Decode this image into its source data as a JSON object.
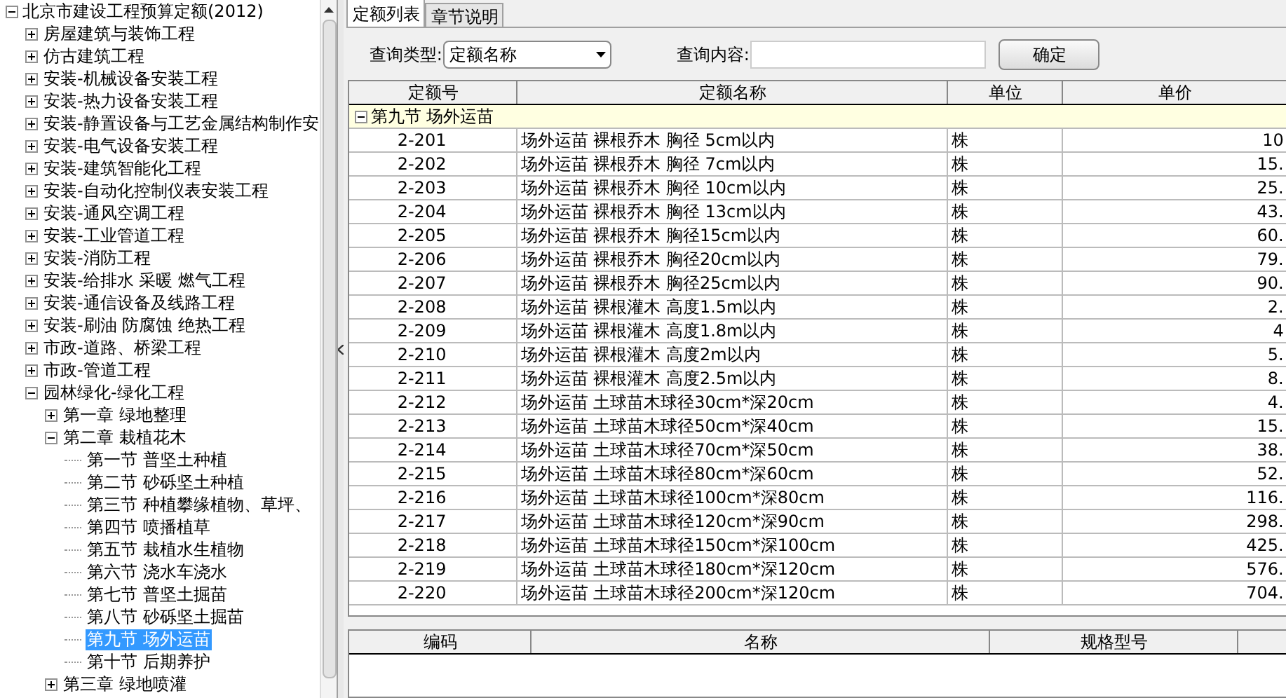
{
  "tree": {
    "label": "北京市建设工程预算定额(2012)",
    "expanded": true,
    "children": [
      {
        "label": "房屋建筑与装饰工程",
        "expanded": false,
        "selected": false
      },
      {
        "label": "仿古建筑工程",
        "expanded": false,
        "selected": false
      },
      {
        "label": "安装-机械设备安装工程",
        "expanded": false,
        "selected": false
      },
      {
        "label": "安装-热力设备安装工程",
        "expanded": false,
        "selected": false
      },
      {
        "label": "安装-静置设备与工艺金属结构制作安",
        "expanded": false,
        "selected": false
      },
      {
        "label": "安装-电气设备安装工程",
        "expanded": false,
        "selected": false
      },
      {
        "label": "安装-建筑智能化工程",
        "expanded": false,
        "selected": false
      },
      {
        "label": "安装-自动化控制仪表安装工程",
        "expanded": false,
        "selected": false
      },
      {
        "label": "安装-通风空调工程",
        "expanded": false,
        "selected": false
      },
      {
        "label": "安装-工业管道工程",
        "expanded": false,
        "selected": false
      },
      {
        "label": "安装-消防工程",
        "expanded": false,
        "selected": false
      },
      {
        "label": "安装-给排水 采暖 燃气工程",
        "expanded": false,
        "selected": false
      },
      {
        "label": "安装-通信设备及线路工程",
        "expanded": false,
        "selected": false
      },
      {
        "label": "安装-刷油 防腐蚀 绝热工程",
        "expanded": false,
        "selected": false
      },
      {
        "label": "市政-道路、桥梁工程",
        "expanded": false,
        "selected": false
      },
      {
        "label": "市政-管道工程",
        "expanded": false,
        "selected": false
      },
      {
        "label": "园林绿化-绿化工程",
        "expanded": true,
        "selected": false,
        "children": [
          {
            "label": "第一章 绿地整理",
            "expanded": false,
            "selected": false
          },
          {
            "label": "第二章 栽植花木",
            "expanded": true,
            "selected": false,
            "children": [
              {
                "label": "第一节 普坚土种植",
                "selected": false
              },
              {
                "label": "第二节 砂砾坚土种植",
                "selected": false
              },
              {
                "label": "第三节 种植攀缘植物、草坪、",
                "selected": false
              },
              {
                "label": "第四节 喷播植草",
                "selected": false
              },
              {
                "label": "第五节 栽植水生植物",
                "selected": false
              },
              {
                "label": "第六节 浇水车浇水",
                "selected": false
              },
              {
                "label": "第七节 普坚土掘苗",
                "selected": false
              },
              {
                "label": "第八节 砂砾坚土掘苗",
                "selected": false
              },
              {
                "label": "第九节 场外运苗",
                "selected": true
              },
              {
                "label": "第十节 后期养护",
                "selected": false
              }
            ]
          },
          {
            "label": "第三章 绿地喷灌",
            "expanded": false,
            "selected": false
          }
        ]
      }
    ]
  },
  "tabs": [
    {
      "label": "定额列表",
      "selected": true
    },
    {
      "label": "章节说明",
      "selected": false
    }
  ],
  "query": {
    "type_label": "查询类型:",
    "type_value": "定额名称",
    "content_label": "查询内容:",
    "confirm": "确定"
  },
  "table": {
    "columns": [
      "定额号",
      "定额名称",
      "单位",
      "单价"
    ],
    "group": {
      "label": "第九节 场外运苗",
      "expanded": true
    },
    "rows": [
      [
        "2-201",
        "场外运苗 裸根乔木 胸径 5cm以内",
        "株",
        "10"
      ],
      [
        "2-202",
        "场外运苗 裸根乔木 胸径 7cm以内",
        "株",
        "15."
      ],
      [
        "2-203",
        "场外运苗 裸根乔木 胸径 10cm以内",
        "株",
        "25."
      ],
      [
        "2-204",
        "场外运苗 裸根乔木 胸径 13cm以内",
        "株",
        "43."
      ],
      [
        "2-205",
        "场外运苗 裸根乔木 胸径15cm以内",
        "株",
        "60."
      ],
      [
        "2-206",
        "场外运苗 裸根乔木 胸径20cm以内",
        "株",
        "79."
      ],
      [
        "2-207",
        "场外运苗 裸根乔木 胸径25cm以内",
        "株",
        "90."
      ],
      [
        "2-208",
        "场外运苗 裸根灌木 高度1.5m以内",
        "株",
        "2."
      ],
      [
        "2-209",
        "场外运苗 裸根灌木 高度1.8m以内",
        "株",
        "4"
      ],
      [
        "2-210",
        "场外运苗 裸根灌木 高度2m以内",
        "株",
        "5."
      ],
      [
        "2-211",
        "场外运苗 裸根灌木 高度2.5m以内",
        "株",
        "8."
      ],
      [
        "2-212",
        "场外运苗 土球苗木球径30cm*深20cm",
        "株",
        "4."
      ],
      [
        "2-213",
        "场外运苗 土球苗木球径50cm*深40cm",
        "株",
        "15."
      ],
      [
        "2-214",
        "场外运苗 土球苗木球径70cm*深50cm",
        "株",
        "38."
      ],
      [
        "2-215",
        "场外运苗 土球苗木球径80cm*深60cm",
        "株",
        "52."
      ],
      [
        "2-216",
        "场外运苗 土球苗木球径100cm*深80cm",
        "株",
        "116."
      ],
      [
        "2-217",
        "场外运苗 土球苗木球径120cm*深90cm",
        "株",
        "298."
      ],
      [
        "2-218",
        "场外运苗 土球苗木球径150cm*深100cm",
        "株",
        "425."
      ],
      [
        "2-219",
        "场外运苗 土球苗木球径180cm*深120cm",
        "株",
        "576."
      ],
      [
        "2-220",
        "场外运苗 土球苗木球径200cm*深120cm",
        "株",
        "704."
      ]
    ]
  },
  "detail_table": {
    "columns": [
      "编码",
      "名称",
      "规格型号"
    ]
  }
}
